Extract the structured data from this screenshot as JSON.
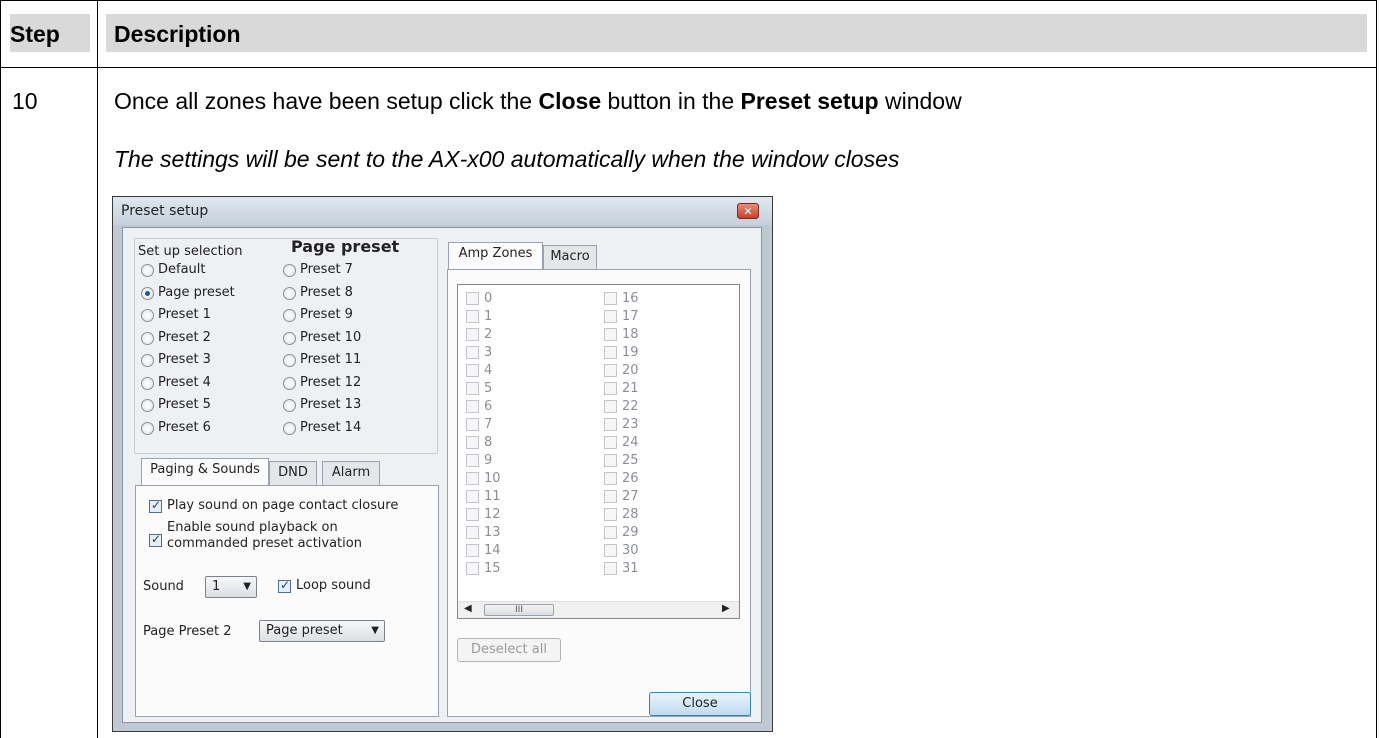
{
  "table": {
    "header_step": "Step",
    "header_description": "Description",
    "step_number": "10",
    "line1": {
      "pre": "Once all zones have been setup click the ",
      "bold1": "Close",
      "mid": " button in the ",
      "bold2": "Preset setup",
      "post": " window"
    },
    "line2": "The settings will be sent to the AX-x00 automatically when the window closes"
  },
  "dialog": {
    "title": "Preset setup",
    "setup_selection_label": "Set up selection",
    "page_preset_heading": "Page preset",
    "radios_col1": [
      "Default",
      "Page preset",
      "Preset 1",
      "Preset 2",
      "Preset 3",
      "Preset 4",
      "Preset 5",
      "Preset 6"
    ],
    "radios_col2": [
      "Preset 7",
      "Preset 8",
      "Preset 9",
      "Preset 10",
      "Preset 11",
      "Preset 12",
      "Preset 13",
      "Preset 14"
    ],
    "selected_radio": "Page preset",
    "left_tabs": [
      "Paging & Sounds",
      "DND",
      "Alarm"
    ],
    "play_sound_label": "Play sound on page contact closure",
    "enable_playback_line1": "Enable sound playback on",
    "enable_playback_line2": "commanded preset activation",
    "sound_label": "Sound",
    "sound_value": "1",
    "loop_sound_label": "Loop sound",
    "page_preset_label": "Page Preset 2",
    "page_preset_value": "Page preset",
    "right_tabs": [
      "Amp Zones",
      "Macro"
    ],
    "zones_col1": [
      "0",
      "1",
      "2",
      "3",
      "4",
      "5",
      "6",
      "7",
      "8",
      "9",
      "10",
      "11",
      "12",
      "13",
      "14",
      "15"
    ],
    "zones_col2": [
      "16",
      "17",
      "18",
      "19",
      "20",
      "21",
      "22",
      "23",
      "24",
      "25",
      "26",
      "27",
      "28",
      "29",
      "30",
      "31"
    ],
    "scroll_thumb": "III",
    "deselect_all": "Deselect all",
    "close_button": "Close"
  }
}
